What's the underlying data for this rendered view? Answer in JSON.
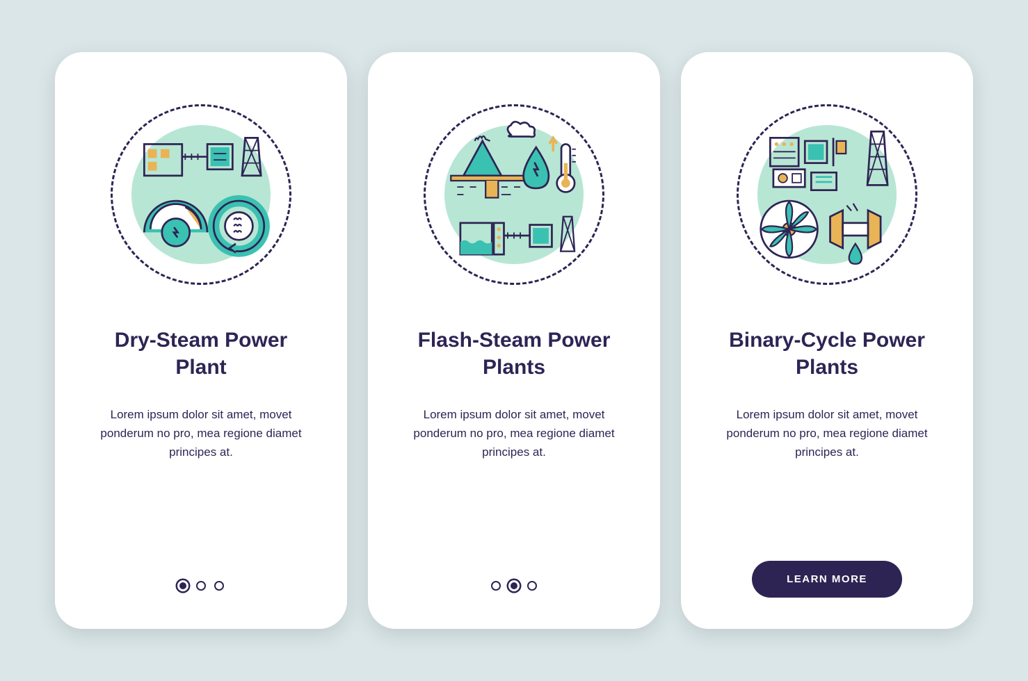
{
  "cards": [
    {
      "title": "Dry-Steam Power Plant",
      "description": "Lorem ipsum dolor sit amet, movet ponderum no pro, mea regione diamet principes at.",
      "active_dot": 0,
      "has_button": false
    },
    {
      "title": "Flash-Steam Power Plants",
      "description": "Lorem ipsum dolor sit amet, movet ponderum no pro, mea regione diamet principes at.",
      "active_dot": 1,
      "has_button": false
    },
    {
      "title": "Binary-Cycle Power Plants",
      "description": "Lorem ipsum dolor sit amet, movet ponderum no pro, mea regione diamet principes at.",
      "active_dot": 2,
      "has_button": true
    }
  ],
  "button_label": "LEARN MORE",
  "colors": {
    "teal": "#3bc1b1",
    "yellow": "#e8b456",
    "purple": "#2e2454",
    "light_teal": "#b8e6d4"
  }
}
